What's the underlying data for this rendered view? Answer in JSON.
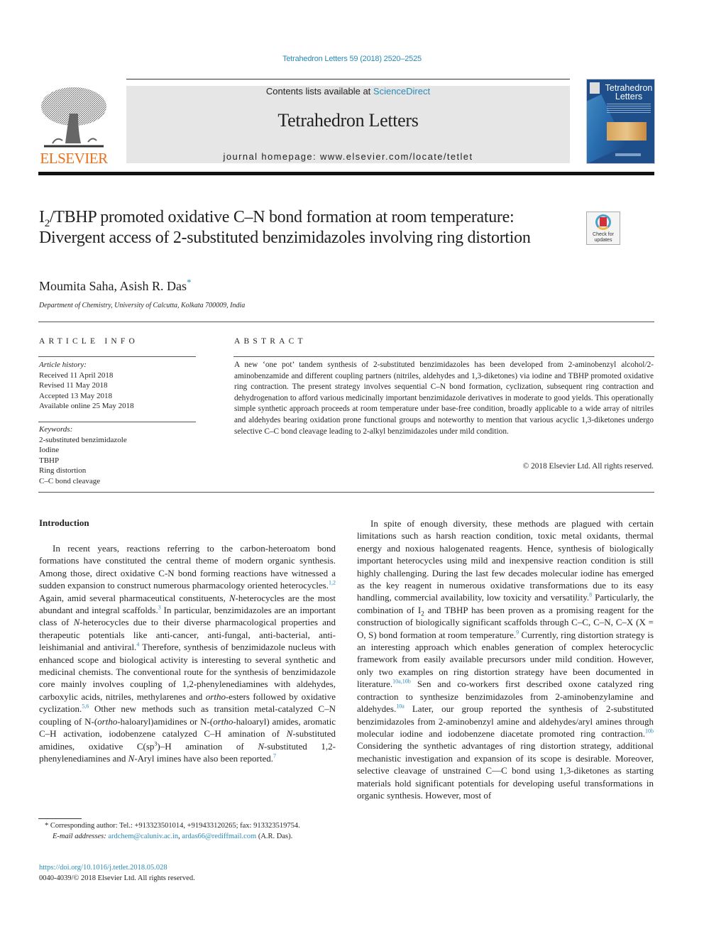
{
  "header": {
    "citation": "Tetrahedron Letters 59 (2018) 2520–2525",
    "contents_prefix": "Contents lists available at ",
    "contents_link": "ScienceDirect",
    "journal_name": "Tetrahedron Letters",
    "homepage_label": "journal homepage: www.elsevier.com/locate/tetlet",
    "publisher_logo": "ELSEVIER",
    "cover_title_line1": "Tetrahedron",
    "cover_title_line2": "Letters",
    "crossmark_label_line1": "Check for",
    "crossmark_label_line2": "updates"
  },
  "article": {
    "title_part1": "I",
    "title_sub": "2",
    "title_part2": "/TBHP promoted oxidative C–N bond formation at room temperature: Divergent access of 2-substituted benzimidazoles involving ring distortion",
    "authors": "Moumita Saha, Asish R. Das",
    "corresponding_marker": "*",
    "affiliation": "Department of Chemistry, University of Calcutta, Kolkata 700009, India"
  },
  "article_info": {
    "heading": "ARTICLE INFO",
    "history_label": "Article history:",
    "history": [
      "Received 11 April 2018",
      "Revised 11 May 2018",
      "Accepted 13 May 2018",
      "Available online 25 May 2018"
    ],
    "keywords_label": "Keywords:",
    "keywords": [
      "2-substituted benzimidazole",
      "Iodine",
      "TBHP",
      "Ring distortion",
      "C–C bond cleavage"
    ]
  },
  "abstract": {
    "heading": "ABSTRACT",
    "text": "A new ‘one pot’ tandem synthesis of 2-substituted benzimidazoles has been developed from 2-aminobenzyl alcohol/2-aminobenzamide and different coupling partners (nitriles, aldehydes and 1,3-diketones) via iodine and TBHP promoted oxidative ring contraction. The present strategy involves sequential C–N bond formation, cyclization, subsequent ring contraction and dehydrogenation to afford various medicinally important benzimidazole derivatives in moderate to good yields. This operationally simple synthetic approach proceeds at room temperature under base-free condition, broadly applicable to a wide array of nitriles and aldehydes bearing oxidation prone functional groups and noteworthy to mention that various acyclic 1,3-diketones undergo selective C–C bond cleavage leading to 2-alkyl benzimidazoles under mild condition.",
    "copyright": "© 2018 Elsevier Ltd. All rights reserved."
  },
  "body": {
    "intro_heading": "Introduction",
    "left": {
      "s1": "In recent years, reactions referring to the carbon-heteroatom bond formations have constituted the central theme of modern organic synthesis. Among those, direct oxidative C-N bond forming reactions have witnessed a sudden expansion to construct numerous pharmacology oriented heterocycles.",
      "r1": "1,2",
      "s2": " Again, amid several pharmaceutical constituents, ",
      "i1": "N",
      "s3": "-heterocycles are the most abundant and integral scaffolds.",
      "r2": "3",
      "s4": " In particular, benzimidazoles are an important class of ",
      "i2": "N",
      "s5": "-heterocycles due to their diverse pharmacological properties and therapeutic potentials like anti-cancer, anti-fungal, anti-bacterial, anti-leishimanial and antiviral.",
      "r3": "4",
      "s6": " Therefore, synthesis of benzimidazole nucleus with enhanced scope and biological activity is interesting to several synthetic and medicinal chemists. The conventional route for the synthesis of benzimidazole core mainly involves coupling of 1,2-phenylenediamines with aldehydes, carboxylic acids, nitriles, methylarenes and ",
      "i3": "ortho",
      "s7": "-esters followed by oxidative cyclization.",
      "r4": "5,6",
      "s8": " Other new methods such as transition metal-catalyzed C–N coupling of N-(",
      "i4": "ortho",
      "s9": "-haloaryl)amidines or N-(",
      "i5": "ortho",
      "s10": "-haloaryl) amides, aromatic C–H activation, iodobenzene catalyzed C–H amination of ",
      "i6": "N",
      "s11": "-substituted amidines, oxidative C(sp",
      "sup1": "3",
      "s12": ")–H amination of ",
      "i7": "N",
      "s13": "-substituted 1,2-phenylenediamines and ",
      "i8": "N",
      "s14": "-Aryl imines have also been reported.",
      "r5": "7"
    },
    "right": {
      "s1": "In spite of enough diversity, these methods are plagued with certain limitations such as harsh reaction condition, toxic metal oxidants, thermal energy and noxious halogenated reagents. Hence, synthesis of biologically important heterocycles using mild and inexpensive reaction condition is still highly challenging. During the last few decades molecular iodine has emerged as the key reagent in numerous oxidative transformations due to its easy handling, commercial availability, low toxicity and versatility.",
      "r1": "8",
      "s2": " Particularly, the combination of I",
      "sub1": "2",
      "s3": " and TBHP has been proven as a promising reagent for the construction of biologically significant scaffolds through C–C, C–N, C–X (X = O, S) bond formation at room temperature.",
      "r2": "9",
      "s4": " Currently, ring distortion strategy is an interesting approach which enables generation of complex heterocyclic framework from easily available precursors under mild condition. However, only two examples on ring distortion strategy have been documented in literature.",
      "r3": "10a,10b",
      "s5": " Sen and co-workers first described oxone catalyzed ring contraction to synthesize benzimidazoles from 2-aminobenzylamine and aldehydes.",
      "r4": "10a",
      "s6": " Later, our group reported the synthesis of 2-substituted benzimidazoles from 2-aminobenzyl amine and aldehydes/aryl amines through molecular iodine and iodobenzene diacetate promoted ring contraction.",
      "r5": "10b",
      "s7": " Considering the synthetic advantages of ring distortion strategy, additional mechanistic investigation and expansion of its scope is desirable. Moreover, selective cleavage of unstrained C—C bond using 1,3-diketones as starting materials hold significant potentials for developing useful transformations in organic synthesis. However, most of"
    }
  },
  "footnote": {
    "corresponding": "* Corresponding author: Tel.: +913323501014, +919433120265; fax: 913323519754.",
    "email_label": "E-mail addresses: ",
    "email1": "ardchem@caluniv.ac.in",
    "email_sep": ", ",
    "email2": "ardas66@rediffmail.com",
    "email_suffix": " (A.R. Das).",
    "doi": "https://doi.org/10.1016/j.tetlet.2018.05.028",
    "issn_copyright": "0040-4039/© 2018 Elsevier Ltd. All rights reserved."
  }
}
